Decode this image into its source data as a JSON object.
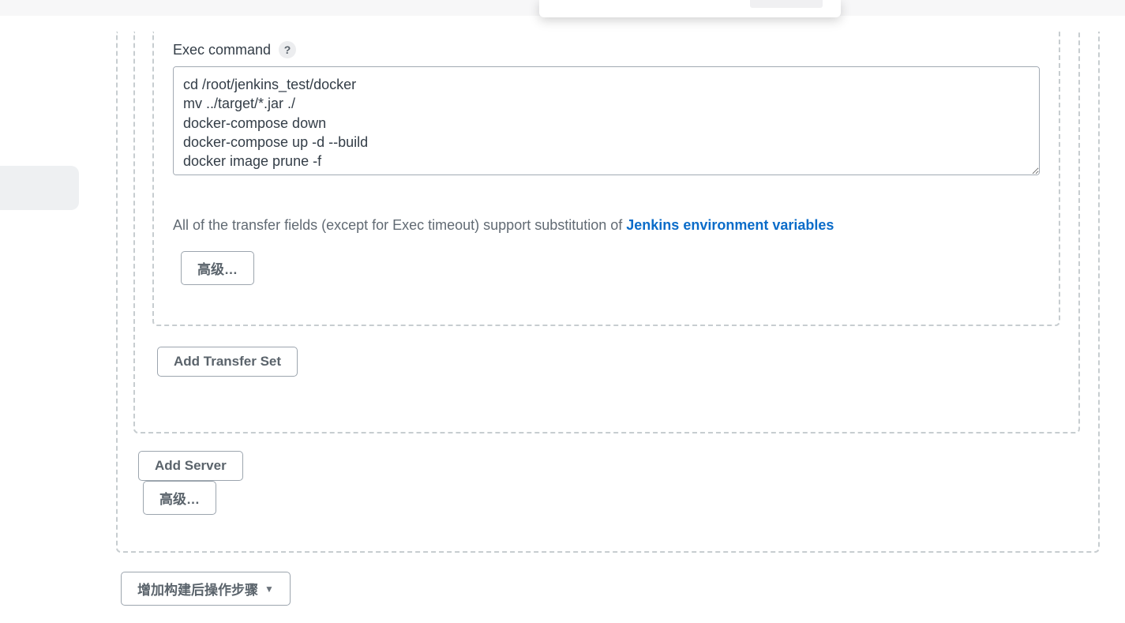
{
  "transfer": {
    "exec_command_label": "Exec command",
    "exec_command_value": "cd /root/jenkins_test/docker\nmv ../target/*.jar ./\ndocker-compose down\ndocker-compose up -d --build\ndocker image prune -f",
    "hint_prefix": "All of the transfer fields (except for Exec timeout) support substitution of ",
    "hint_link_text": "Jenkins environment variables",
    "advanced_btn": "高级…"
  },
  "server": {
    "add_transfer_set_btn": "Add Transfer Set",
    "add_server_btn": "Add Server",
    "advanced_btn": "高级…"
  },
  "post_build": {
    "add_step_btn": "增加构建后操作步骤"
  },
  "icons": {
    "help": "?",
    "caret_down": "▼"
  }
}
